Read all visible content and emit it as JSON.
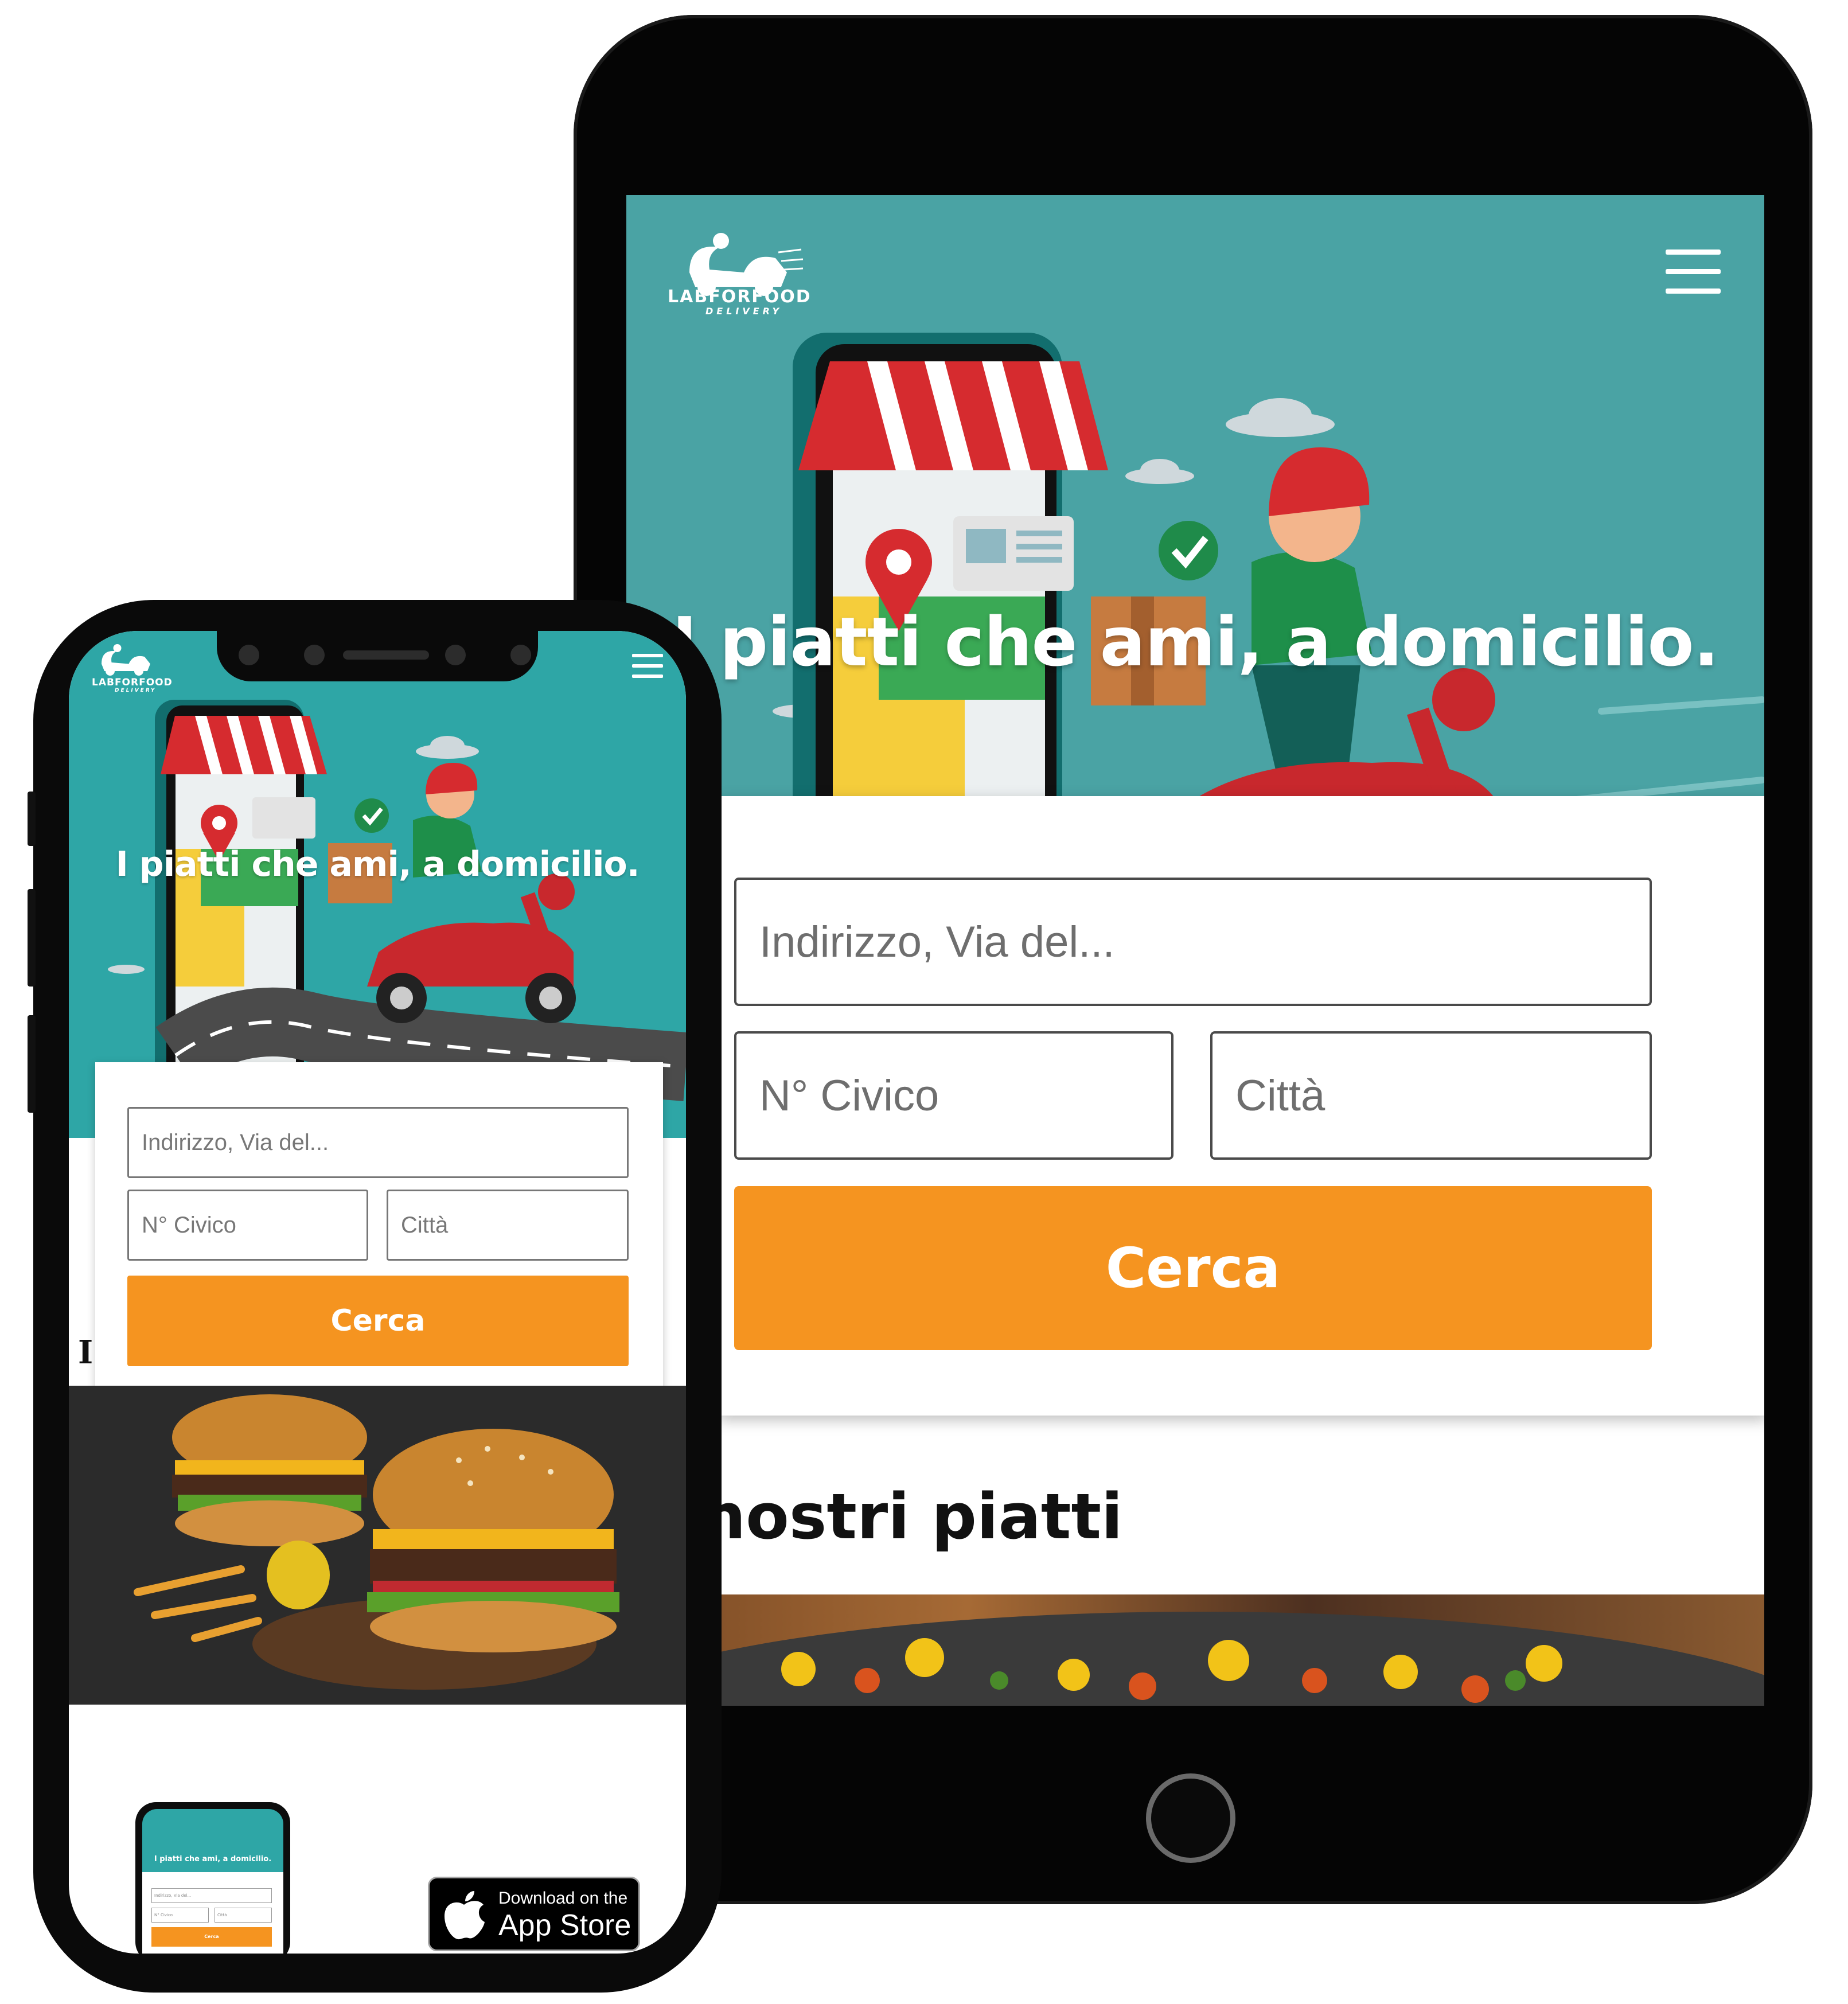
{
  "brand": {
    "name": "LABFORFOOD",
    "tagline": "DELIVERY",
    "colors": {
      "teal": "#4aa3a4",
      "orange": "#f59420",
      "red": "#c8282d"
    }
  },
  "tablet": {
    "hero_title": "I piatti che ami, a domicilio.",
    "menu_icon": "hamburger-menu-icon",
    "form": {
      "address_placeholder": "Indirizzo, Via del...",
      "civic_placeholder": "N° Civico",
      "city_placeholder": "Città",
      "search_label": "Cerca"
    },
    "section_title": "nostri piatti"
  },
  "phone": {
    "hero_title": "I piatti che ami, a domicilio.",
    "menu_icon": "hamburger-menu-icon",
    "form": {
      "address_placeholder": "Indirizzo, Via del...",
      "civic_placeholder": "N° Civico",
      "city_placeholder": "Città",
      "search_label": "Cerca"
    },
    "section_initial": "I",
    "app_store": {
      "line1": "Download on the",
      "line2": "App Store"
    },
    "mini_preview": {
      "title": "I piatti che ami, a domicilio.",
      "address_placeholder": "Indirizzo, Via del...",
      "civic_placeholder": "N° Civico",
      "city_placeholder": "Città",
      "search_label": "Cerca"
    }
  }
}
